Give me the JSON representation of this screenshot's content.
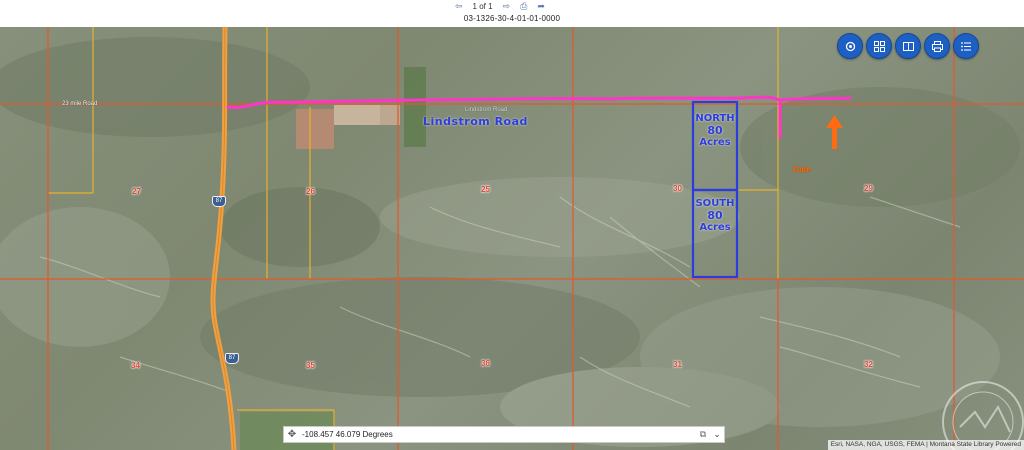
{
  "header": {
    "page_indicator": "1 of 1",
    "parcel_id": "03-1326-30-4-01-01-0000"
  },
  "toolbar": {
    "buttons": [
      {
        "name": "locate-icon"
      },
      {
        "name": "basemap-gallery-icon"
      },
      {
        "name": "compare-icon"
      },
      {
        "name": "print-icon"
      },
      {
        "name": "layer-list-icon"
      }
    ],
    "accent_color": "#1d5fc2"
  },
  "map": {
    "road_name": "Lindstrom Road",
    "road_label_small": "23 mile Road",
    "road_label_faint": "Lindstrom Road",
    "north_parcel": [
      "NORTH",
      "80",
      "Acres"
    ],
    "south_parcel": [
      "SOUTH",
      "80",
      "Acres"
    ],
    "gate_label": "Gate",
    "section_labels": [
      "27",
      "26",
      "25",
      "30",
      "29",
      "34",
      "35",
      "36",
      "31",
      "32"
    ],
    "highway_shield": "87",
    "colors": {
      "section_line": "#e25a2c",
      "quarter_line": "#e8b22a",
      "route": "#ff35c8",
      "parcel_outline": "#2c3de0",
      "arrow": "#ff6a12"
    }
  },
  "coordinates": {
    "value": "-108.457 46.079 Degrees"
  },
  "attribution": "Esri, NASA, NGA, USGS, FEMA | Montana State Library",
  "attribution_powered": "Powered"
}
